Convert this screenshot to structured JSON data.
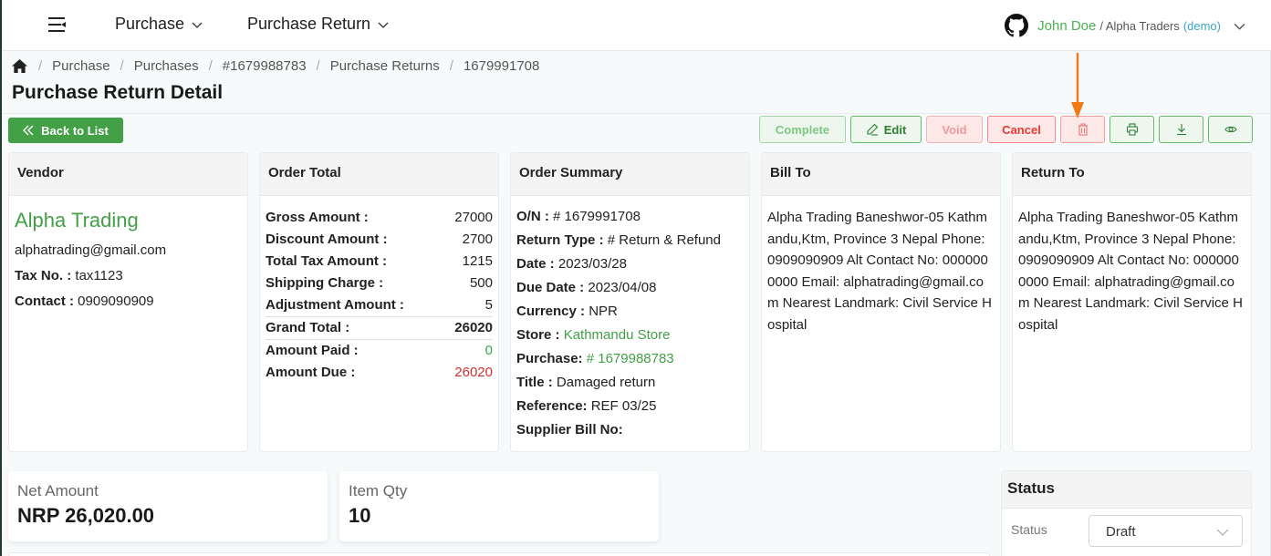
{
  "topbar": {
    "nav": [
      {
        "label": "Purchase"
      },
      {
        "label": "Purchase Return"
      }
    ],
    "user": {
      "name": "John Doe",
      "company": "/ Alpha Traders",
      "tag": "(demo)"
    }
  },
  "breadcrumb": [
    "Purchase",
    "Purchases",
    "#1679988783",
    "Purchase Returns",
    "1679991708"
  ],
  "page_title": "Purchase Return Detail",
  "back_button": "Back to List",
  "actions": {
    "complete": "Complete",
    "edit": "Edit",
    "void": "Void",
    "cancel": "Cancel"
  },
  "vendor": {
    "header": "Vendor",
    "name": "Alpha Trading",
    "email": "alphatrading@gmail.com",
    "tax_label": "Tax No. :",
    "tax_value": "tax1123",
    "contact_label": "Contact :",
    "contact_value": "0909090909"
  },
  "order_total": {
    "header": "Order Total",
    "rows": [
      {
        "label": "Gross Amount :",
        "value": "27000"
      },
      {
        "label": "Discount Amount :",
        "value": "2700"
      },
      {
        "label": "Total Tax Amount :",
        "value": "1215"
      },
      {
        "label": "Shipping Charge :",
        "value": "500"
      },
      {
        "label": "Adjustment Amount :",
        "value": "5"
      },
      {
        "label": "Grand Total :",
        "value": "26020"
      },
      {
        "label": "Amount Paid :",
        "value": "0"
      },
      {
        "label": "Amount Due :",
        "value": "26020"
      }
    ]
  },
  "order_summary": {
    "header": "Order Summary",
    "on_label": "O/N :",
    "on_value": "# 1679991708",
    "return_type_label": "Return Type :",
    "return_type_value": "# Return & Refund",
    "date_label": "Date :",
    "date_value": "2023/03/28",
    "due_date_label": "Due Date :",
    "due_date_value": "2023/04/08",
    "currency_label": "Currency :",
    "currency_value": "NPR",
    "store_label": "Store :",
    "store_value": "Kathmandu Store",
    "purchase_label": "Purchase:",
    "purchase_value": "# 1679988783",
    "title_label": "Title :",
    "title_value": "Damaged return",
    "reference_label": "Reference:",
    "reference_value": "REF 03/25",
    "supplier_bill_label": "Supplier Bill No:",
    "supplier_bill_value": ""
  },
  "bill_to": {
    "header": "Bill To",
    "address": "Alpha Trading Baneshwor-05 Kathmandu,Ktm, Province 3 Nepal Phone: 0909090909 Alt Contact No: 0000000000 Email: alphatrading@gmail.com Nearest Landmark: Civil Service Hospital"
  },
  "return_to": {
    "header": "Return To",
    "address": "Alpha Trading Baneshwor-05 Kathmandu,Ktm, Province 3 Nepal Phone: 0909090909 Alt Contact No: 0000000000 Email: alphatrading@gmail.com Nearest Landmark: Civil Service Hospital"
  },
  "stats": {
    "net_amount_label": "Net Amount",
    "net_amount_value": "NRP 26,020.00",
    "item_qty_label": "Item Qty",
    "item_qty_value": "10"
  },
  "status_panel": {
    "header": "Status",
    "label": "Status",
    "selected": "Draft"
  }
}
